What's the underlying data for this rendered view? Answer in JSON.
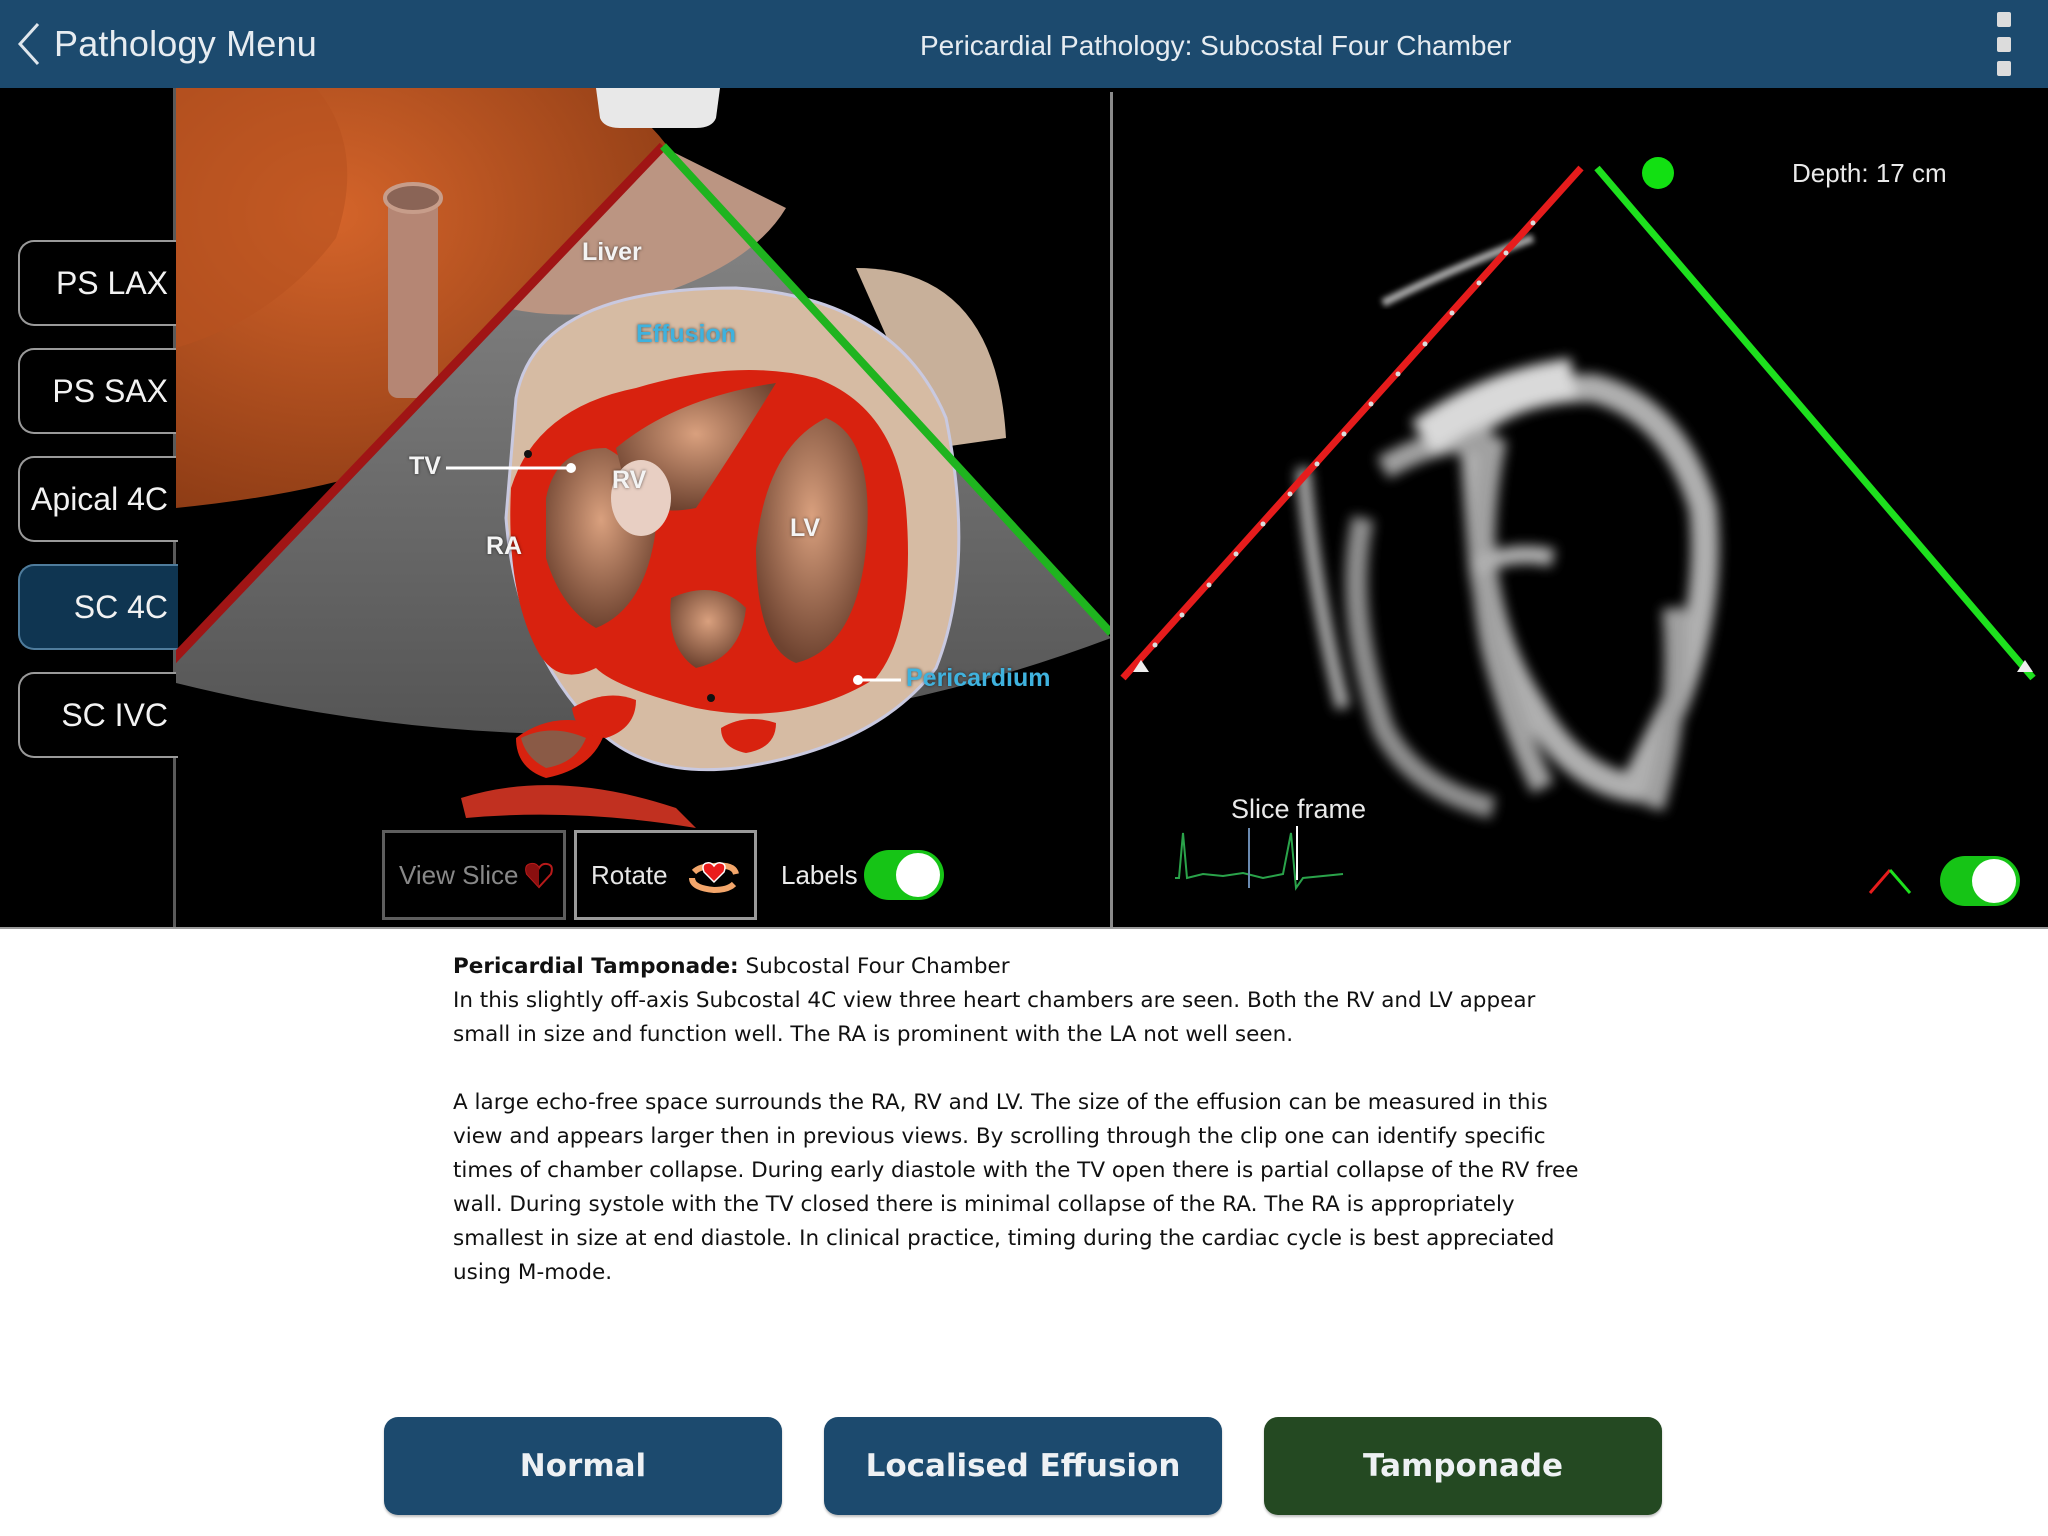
{
  "header": {
    "back_label": "Pathology Menu",
    "title": "Pericardial Pathology: Subcostal Four Chamber",
    "menu_icon": "more-vertical-icon"
  },
  "sidebar": {
    "items": [
      {
        "label": "PS LAX",
        "active": false
      },
      {
        "label": "PS SAX",
        "active": false
      },
      {
        "label": "Apical 4C",
        "active": false
      },
      {
        "label": "SC 4C",
        "active": true
      },
      {
        "label": "SC IVC",
        "active": false
      }
    ]
  },
  "anatomy": {
    "labels": {
      "liver": "Liver",
      "effusion": "Effusion",
      "tv": "TV",
      "rv": "RV",
      "ra": "RA",
      "lv": "LV",
      "pericardium": "Pericardium"
    },
    "controls": {
      "view_slice": "View Slice",
      "view_slice_enabled": false,
      "rotate": "Rotate",
      "labels_toggle_label": "Labels",
      "labels_toggle_on": true
    }
  },
  "echo": {
    "depth": "Depth: 17 cm",
    "slice_frame_label": "Slice frame",
    "sector_toggle_on": true
  },
  "description": {
    "title_bold": "Pericardial Tamponade:",
    "title_rest": " Subcostal Four Chamber",
    "para1": "In this slightly off-axis Subcostal 4C view three heart chambers are seen. Both the RV and LV appear small in size and function well. The RA is prominent with the LA not well seen.",
    "para2": "A large echo-free space surrounds the RA, RV and LV. The size of the effusion can be measured in this view and appears larger then in previous views. By scrolling through the clip one can identify specific times of chamber collapse. During early diastole with the TV open there is partial collapse of the RV free wall. During systole with the TV closed there is minimal collapse of the RA. The RA is appropriately smallest in size at end diastole. In clinical practice, timing during the cardiac cycle is best appreciated using M-mode."
  },
  "pathology_buttons": [
    {
      "label": "Normal",
      "active": false
    },
    {
      "label": "Localised Effusion",
      "active": false
    },
    {
      "label": "Tamponade",
      "active": true
    }
  ],
  "colors": {
    "header_bg": "#1c4a6e",
    "active_tab": "#0f3551",
    "active_pathology": "#244922",
    "toggle_on": "#16c416",
    "sector_left": "#e01818",
    "sector_right": "#1fd01f",
    "label_blue": "#3fb2de"
  }
}
